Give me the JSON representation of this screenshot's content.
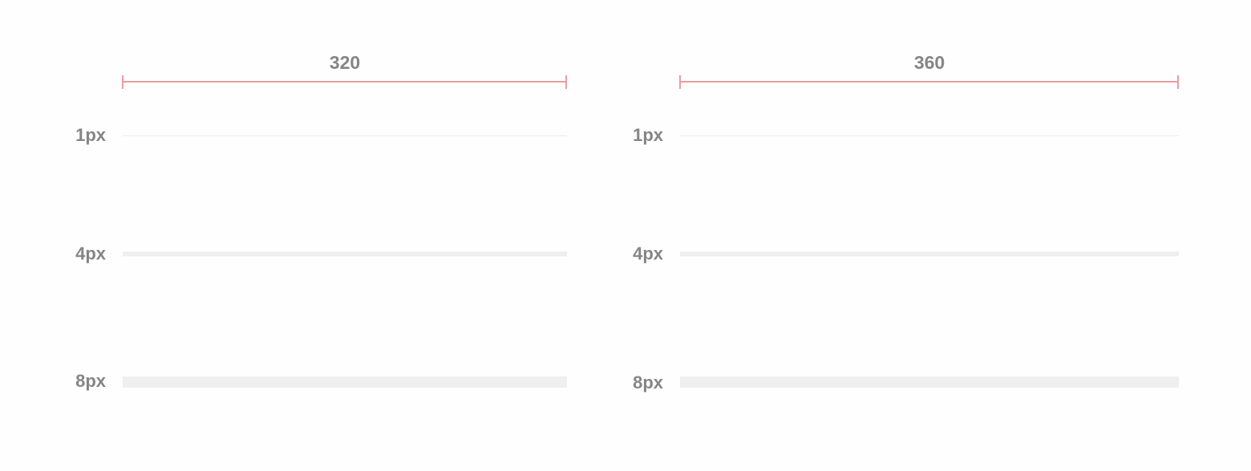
{
  "colors": {
    "measure": "#ee9c9c",
    "divider": "#efefef",
    "label": "#858585"
  },
  "panels": [
    {
      "width_label": "320",
      "rows": [
        {
          "label": "1px"
        },
        {
          "label": "4px"
        },
        {
          "label": "8px"
        }
      ]
    },
    {
      "width_label": "360",
      "rows": [
        {
          "label": "1px"
        },
        {
          "label": "4px"
        },
        {
          "label": "8px"
        }
      ]
    }
  ]
}
